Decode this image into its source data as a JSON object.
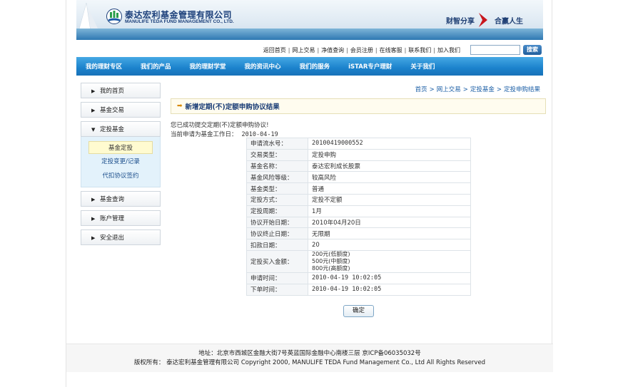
{
  "banner": {
    "company_cn": "泰达宏利基金管理有限公司",
    "company_en": "MANULIFE TEDA FUND MANAGEMENT CO., LTD.",
    "slogan_left": "财智分享",
    "slogan_right": "合赢人生"
  },
  "toplinks": {
    "items": [
      "返回首页",
      "网上交易",
      "净值查询",
      "会员注册",
      "在线客服",
      "联系我们",
      "加入我们"
    ],
    "search_value": "",
    "search_button": "搜索"
  },
  "nav": {
    "items": [
      "我的理财专区",
      "我们的产品",
      "我的理财学堂",
      "我的资讯中心",
      "我们的服务",
      "iSTAR专户理财",
      "关于我们"
    ]
  },
  "sidebar": {
    "items": [
      {
        "label": "我的首页",
        "arrow": "▶"
      },
      {
        "label": "基金交易",
        "arrow": "▶"
      },
      {
        "label": "定投基金",
        "arrow": "▼"
      },
      {
        "label": "基金查询",
        "arrow": "▶"
      },
      {
        "label": "账户管理",
        "arrow": "▶"
      },
      {
        "label": "安全退出",
        "arrow": "▶"
      }
    ],
    "submenu": [
      "基金定投",
      "定投变更/记录",
      "代扣协议签约"
    ]
  },
  "breadcrumb": {
    "items": [
      "首页",
      "网上交易",
      "定投基金",
      "定投申购结果"
    ]
  },
  "title": "新增定期(不)定额申购协议结果",
  "message": "您已成功提交定期(不)定额申购协议!",
  "workday": {
    "label": "当前申请为基金工作日：",
    "value": "2010-04-19"
  },
  "details": [
    {
      "key": "申请流水号：",
      "value": "20100419000552"
    },
    {
      "key": "交易类型：",
      "value": "定投申购"
    },
    {
      "key": "基金名称：",
      "value": "泰达宏利成长股票"
    },
    {
      "key": "基金风险等级：",
      "value": "较高风险"
    },
    {
      "key": "基金类型：",
      "value": "普通"
    },
    {
      "key": "定投方式：",
      "value": "定投不定额"
    },
    {
      "key": "定投周期：",
      "value": "1月"
    },
    {
      "key": "协议开始日期：",
      "value": "2010年04月20日"
    },
    {
      "key": "协议终止日期：",
      "value": "无限期"
    },
    {
      "key": "扣款日期：",
      "value": "20"
    },
    {
      "key": "定投买入金额：",
      "lines": [
        "200元(低额度)",
        "500元(中额度)",
        "800元(高额度)"
      ]
    },
    {
      "key": "申请时间：",
      "value": "2010-04-19 10:02:05"
    },
    {
      "key": "下单时间：",
      "value": "2010-04-19 10:02:05"
    }
  ],
  "confirm_button": "确定",
  "footer": {
    "address": "地址：北京市西城区金融大街7号英蓝国际金融中心南楼三层 京ICP备06035032号",
    "copyright": "版权所有：  泰达宏利基金管理有限公司  Copyright 2000, MANULIFE TEDA Fund Management Co., Ltd All Rights Reserved"
  }
}
